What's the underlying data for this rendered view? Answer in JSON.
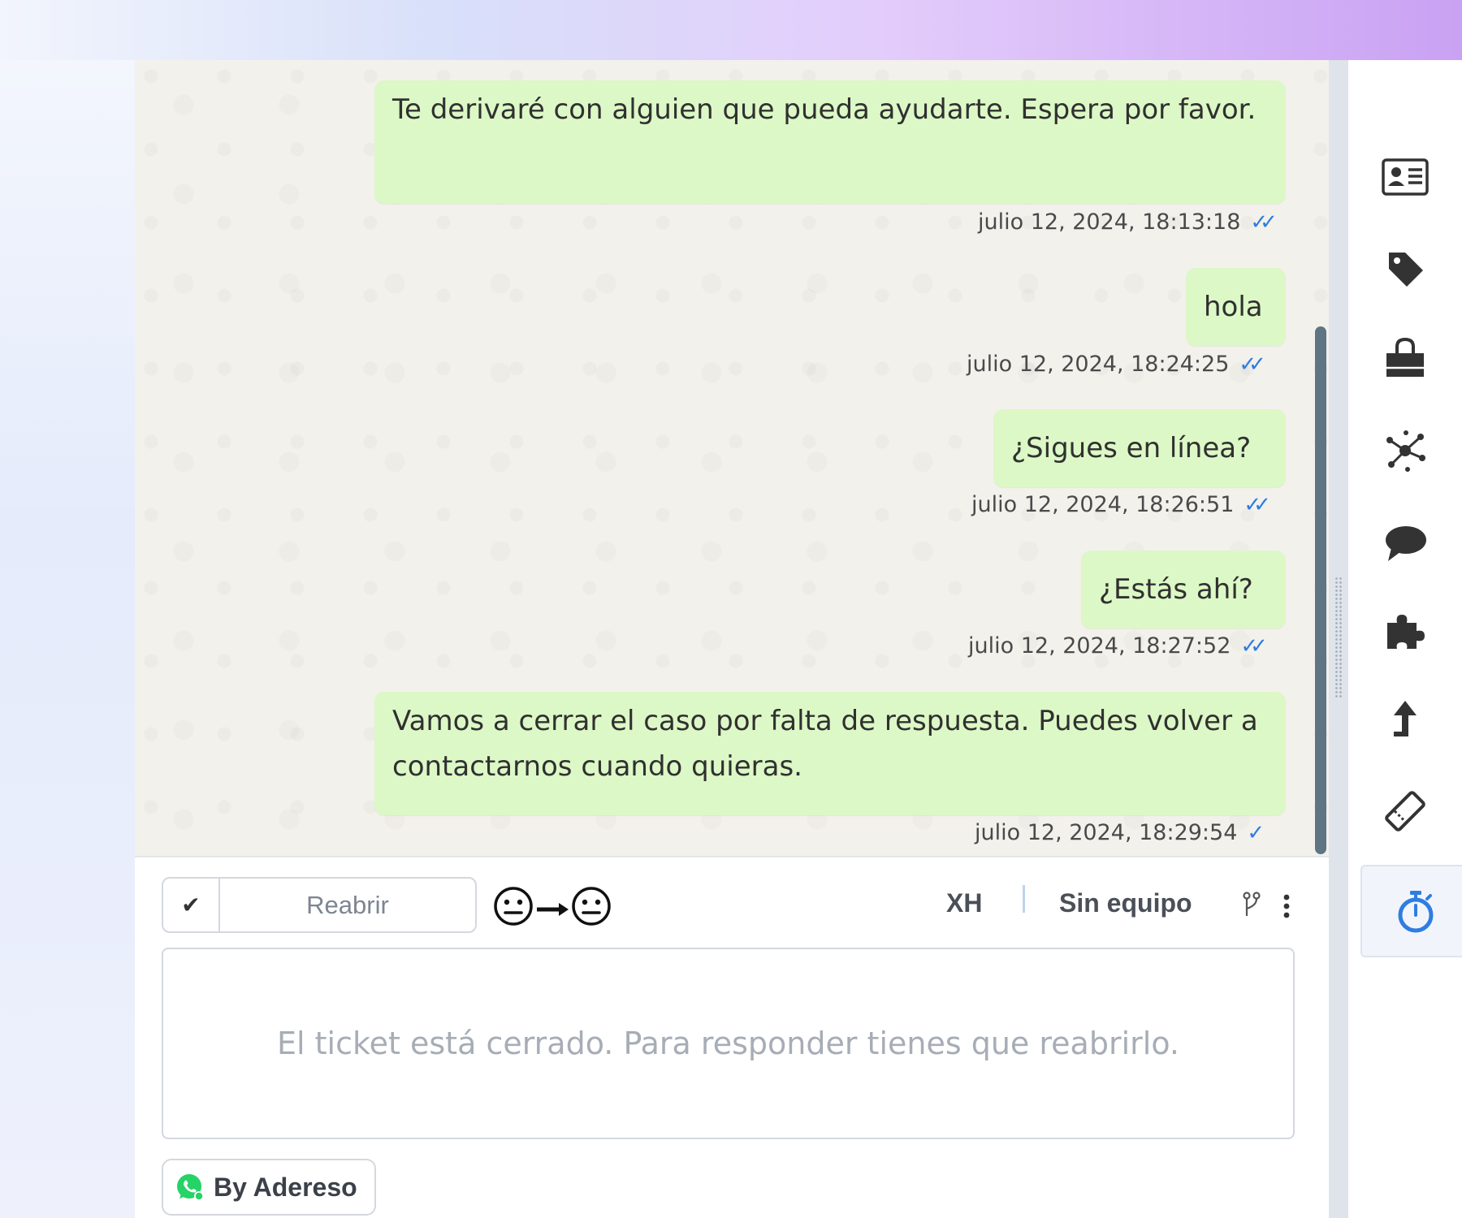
{
  "messages": [
    {
      "text": "Te derivaré con alguien que pueda ayudarte. Espera por favor.",
      "timestamp": "julio 12, 2024, 18:13:18",
      "status": "read"
    },
    {
      "text": "hola",
      "timestamp": "julio 12, 2024, 18:24:25",
      "status": "read"
    },
    {
      "text": "¿Sigues en línea?",
      "timestamp": "julio 12, 2024, 18:26:51",
      "status": "read"
    },
    {
      "text": "¿Estás ahí?",
      "timestamp": "julio 12, 2024, 18:27:52",
      "status": "read"
    },
    {
      "text": "Vamos a cerrar el caso por falta de respuesta. Puedes volver a contactarnos cuando quieras.",
      "timestamp": "julio 12, 2024, 18:29:54",
      "status": "sent"
    }
  ],
  "composer": {
    "reopen_label": "Reabrir",
    "sentiment_from": "neutral-face",
    "sentiment_to": "neutral-face",
    "agent_initials": "XH",
    "team_label": "Sin equipo",
    "closed_message": "El ticket está cerrado. Para responder tienes que reabrirlo.",
    "channel_label": "By Adereso",
    "channel_icon": "whatsapp-icon"
  },
  "rail": {
    "icons": [
      "contact-card-icon",
      "tag-icon",
      "shopping-bag-icon",
      "network-icon",
      "chat-bubble-icon",
      "puzzle-icon",
      "escalate-arrow-icon",
      "ticket-icon",
      "stopwatch-icon"
    ],
    "active": "stopwatch-icon"
  },
  "colors": {
    "bubble": "#dcf8c6",
    "read_tick": "#2f7de1",
    "accent": "#2f7de1",
    "scrollbar": "#5f7584"
  }
}
